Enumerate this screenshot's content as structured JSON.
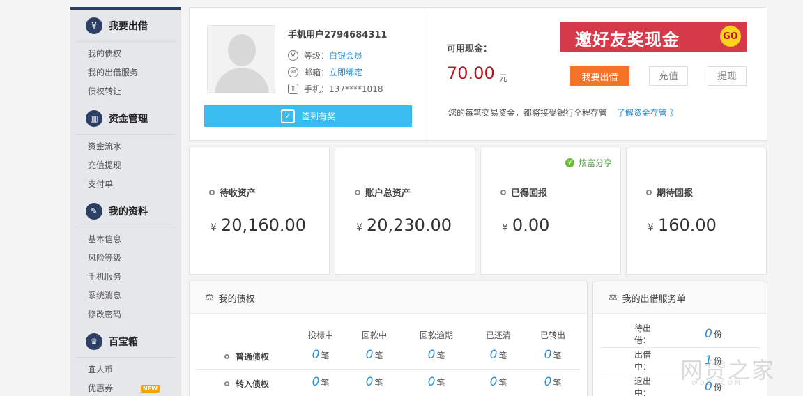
{
  "sidebar": {
    "sections": [
      {
        "title": "我要出借",
        "icon": "wallet-icon",
        "items": [
          "我的债权",
          "我的出借服务",
          "债权转让"
        ]
      },
      {
        "title": "资金管理",
        "icon": "chart-icon",
        "items": [
          "资金流水",
          "充值提现",
          "支付单"
        ]
      },
      {
        "title": "我的资料",
        "icon": "edit-icon",
        "items": [
          "基本信息",
          "风险等级",
          "手机服务",
          "系统消息",
          "修改密码"
        ]
      },
      {
        "title": "百宝箱",
        "icon": "treasure-icon",
        "items": [
          "宜人币",
          "优惠券"
        ]
      }
    ],
    "new_badge": "NEW"
  },
  "user": {
    "name": "手机用户2794684311",
    "level_label": "等级：",
    "level_value": "白银会员",
    "email_label": "邮箱：",
    "email_value": "立即绑定",
    "phone_label": "手机：",
    "phone_value": "137****1018",
    "signin_label": "签到有奖"
  },
  "account": {
    "cash_label": "可用现金：",
    "cash_value": "70.00",
    "cash_unit": "元",
    "promo_text": "邀好友奖现金",
    "promo_go": "GO",
    "lend_button": "我要出借",
    "recharge_button": "充值",
    "withdraw_button": "提现",
    "note": "您的每笔交易资金，都将接受银行全程存管",
    "note_link": "了解资金存管 》"
  },
  "stats": [
    {
      "label": "待收资产",
      "value": "20,160.00"
    },
    {
      "label": "账户总资产",
      "value": "20,230.00"
    },
    {
      "label": "已得回报",
      "value": "0.00"
    },
    {
      "label": "期待回报",
      "value": "160.00"
    }
  ],
  "currency_symbol": "¥",
  "share_label": "炫富分享",
  "claims": {
    "title": "我的债权",
    "columns": [
      "投标中",
      "回款中",
      "回款逾期",
      "已还清",
      "已转出"
    ],
    "unit": "笔",
    "rows": [
      {
        "label": "普通债权",
        "values": [
          "0",
          "0",
          "0",
          "0",
          "0"
        ]
      },
      {
        "label": "转入债权",
        "values": [
          "0",
          "0",
          "0",
          "0",
          "0"
        ]
      }
    ]
  },
  "orders": {
    "title": "我的出借服务单",
    "unit": "份",
    "rows": [
      {
        "label": "待出借：",
        "value": "0"
      },
      {
        "label": "出借中：",
        "value": "1"
      },
      {
        "label": "退出中：",
        "value": "0"
      }
    ]
  },
  "watermark": {
    "main": "网贷之家",
    "sub": "WDZJ.COM"
  }
}
